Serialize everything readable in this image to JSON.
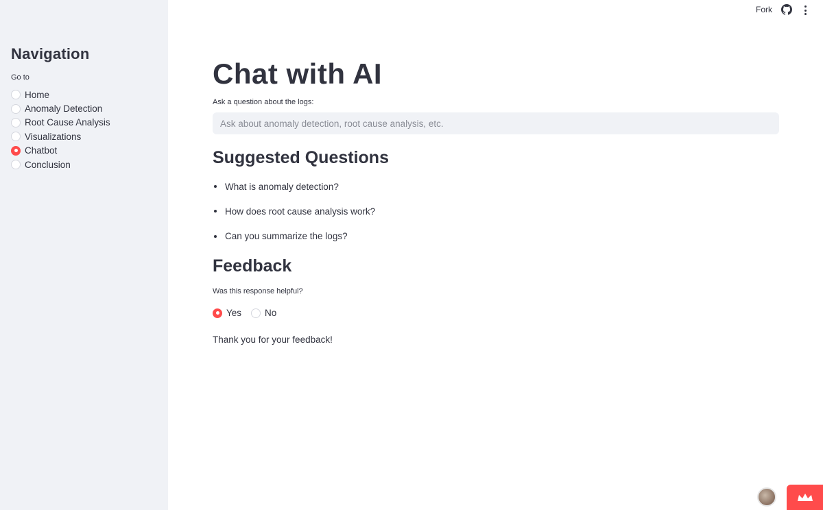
{
  "header": {
    "fork_label": "Fork",
    "github_icon": "github-icon",
    "menu_icon": "kebab-menu-icon"
  },
  "sidebar": {
    "title": "Navigation",
    "radio_label": "Go to",
    "items": [
      {
        "label": "Home",
        "selected": false
      },
      {
        "label": "Anomaly Detection",
        "selected": false
      },
      {
        "label": "Root Cause Analysis",
        "selected": false
      },
      {
        "label": "Visualizations",
        "selected": false
      },
      {
        "label": "Chatbot",
        "selected": true
      },
      {
        "label": "Conclusion",
        "selected": false
      }
    ]
  },
  "main": {
    "title": "Chat with AI",
    "ask_label": "Ask a question about the logs:",
    "ask_value": "",
    "ask_placeholder": "Ask about anomaly detection, root cause analysis, etc.",
    "suggested_heading": "Suggested Questions",
    "suggested": [
      "What is anomaly detection?",
      "How does root cause analysis work?",
      "Can you summarize the logs?"
    ],
    "feedback_heading": "Feedback",
    "feedback_question": "Was this response helpful?",
    "feedback_options": [
      {
        "label": "Yes",
        "selected": true
      },
      {
        "label": "No",
        "selected": false
      }
    ],
    "thanks": "Thank you for your feedback!"
  },
  "colors": {
    "accent": "#ff4b4b",
    "sidebar_bg": "#f0f2f6",
    "text": "#31333f"
  }
}
